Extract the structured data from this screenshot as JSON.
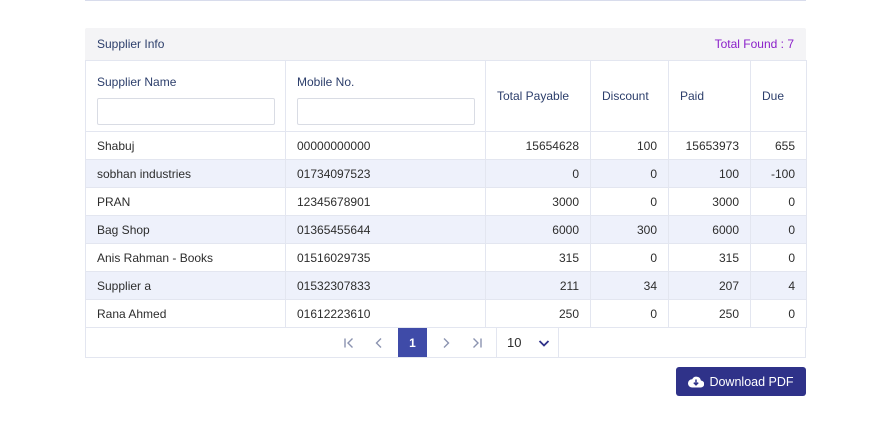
{
  "card": {
    "title": "Supplier Info",
    "total_found": "Total Found : 7"
  },
  "table": {
    "columns": [
      "Supplier Name",
      "Mobile No.",
      "Total Payable",
      "Discount",
      "Paid",
      "Due"
    ],
    "filters": {
      "supplier_name": "",
      "mobile_no": ""
    },
    "rows": [
      [
        "Shabuj",
        "00000000000",
        "15654628",
        "100",
        "15653973",
        "655"
      ],
      [
        "sobhan industries",
        "01734097523",
        "0",
        "0",
        "100",
        "-100"
      ],
      [
        "PRAN",
        "12345678901",
        "3000",
        "0",
        "3000",
        "0"
      ],
      [
        "Bag Shop",
        "01365455644",
        "6000",
        "300",
        "6000",
        "0"
      ],
      [
        "Anis Rahman - Books",
        "01516029735",
        "315",
        "0",
        "315",
        "0"
      ],
      [
        "Supplier a",
        "01532307833",
        "211",
        "34",
        "207",
        "4"
      ],
      [
        "Rana Ahmed",
        "01612223610",
        "250",
        "0",
        "250",
        "0"
      ]
    ]
  },
  "pagination": {
    "current_page": "1",
    "page_size": "10"
  },
  "actions": {
    "download_label": "Download PDF"
  },
  "colors": {
    "accent": "#3f4ba8",
    "button": "#2f3289",
    "total_found": "#8a1fc9",
    "row_alt": "#eef1fb"
  },
  "icons": {
    "first": "first-page-icon",
    "prev": "prev-page-icon",
    "next": "next-page-icon",
    "last": "last-page-icon",
    "dropdown": "chevron-down-icon",
    "download": "cloud-download-icon"
  }
}
